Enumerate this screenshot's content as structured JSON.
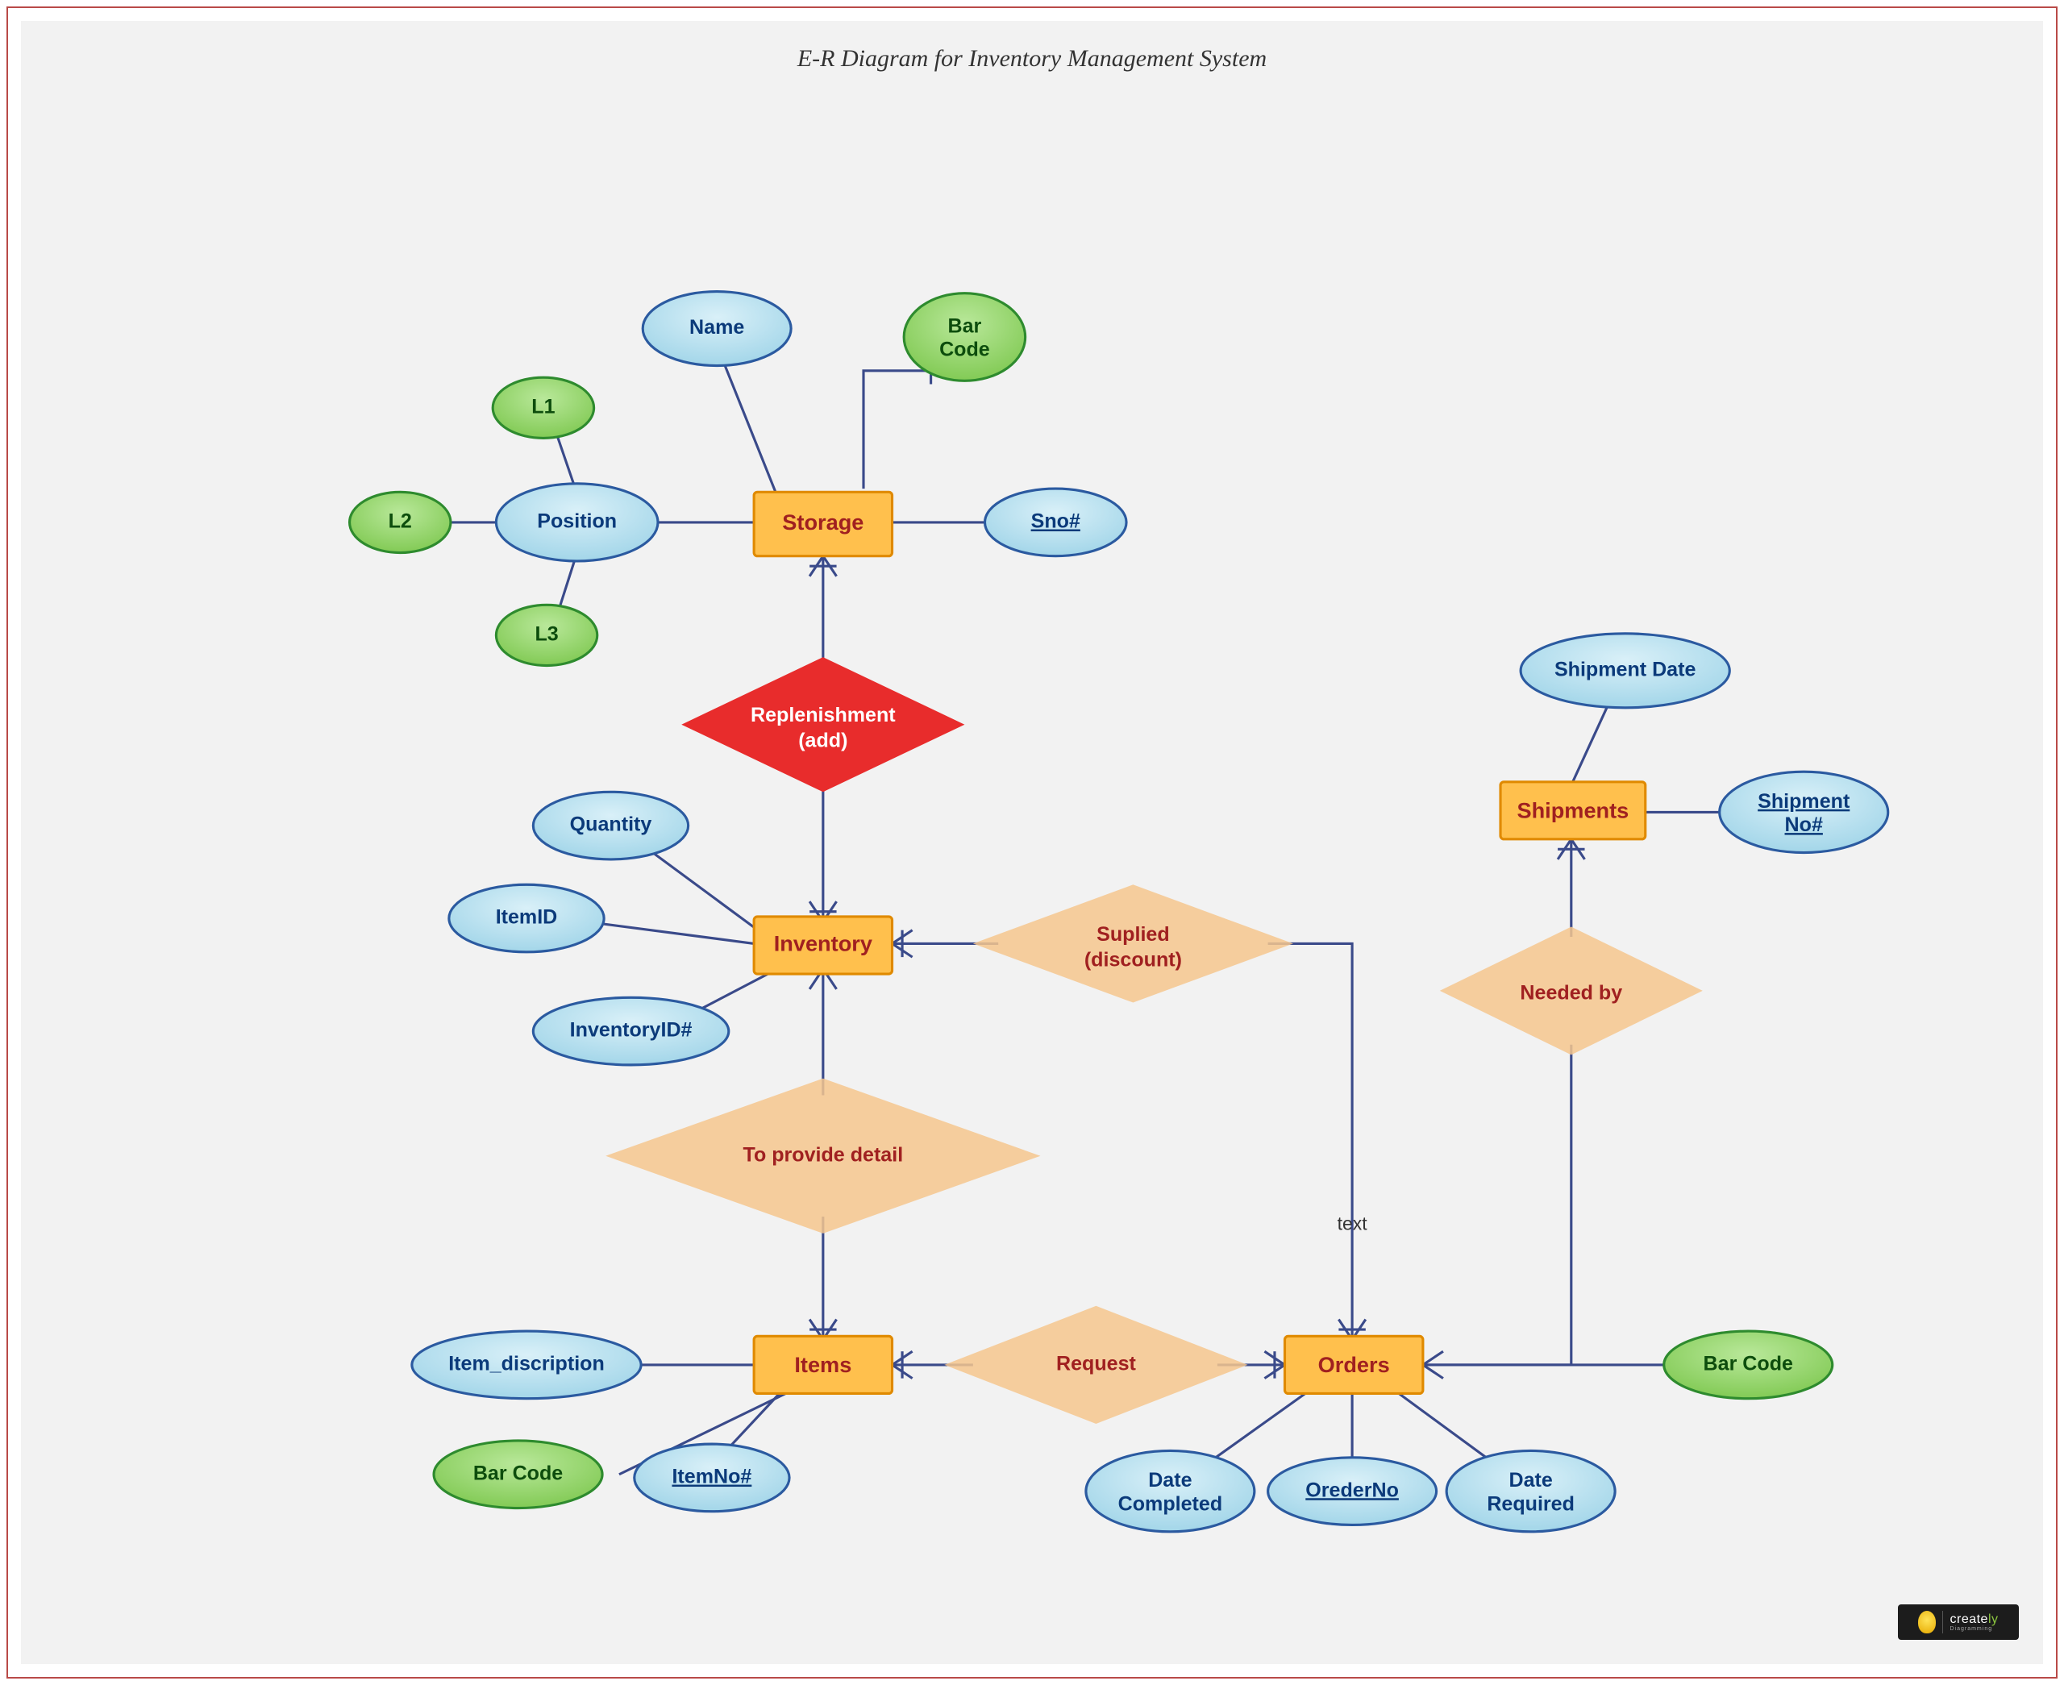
{
  "title": "E-R Diagram for Inventory Management System",
  "entities": {
    "storage": "Storage",
    "inventory": "Inventory",
    "items": "Items",
    "orders": "Orders",
    "shipments": "Shipments"
  },
  "relationships": {
    "replenishment": "Replenishment\n(add)",
    "supplied": "Suplied\n(discount)",
    "provide": "To provide detail",
    "request": "Request",
    "needed": "Needed by"
  },
  "attributes": {
    "storage": {
      "name": "Name",
      "barcode": "Bar\nCode",
      "sno": "Sno#",
      "position": "Position",
      "l1": "L1",
      "l2": "L2",
      "l3": "L3"
    },
    "inventory": {
      "quantity": "Quantity",
      "itemid": "ItemID",
      "inventoryid": "InventoryID#"
    },
    "items": {
      "desc": "Item_discription",
      "barcode": "Bar Code",
      "itemno": "ItemNo#"
    },
    "orders": {
      "dateCompleted": "Date\nCompleted",
      "orderNo": "OrederNo",
      "dateRequired": "Date\nRequired",
      "barcode": "Bar Code"
    },
    "shipments": {
      "date": "Shipment Date",
      "no": "Shipment\nNo#"
    }
  },
  "edgeLabels": {
    "text": "text"
  },
  "logo": {
    "brand1": "create",
    "brand2": "ly",
    "sub": "Diagramming"
  }
}
